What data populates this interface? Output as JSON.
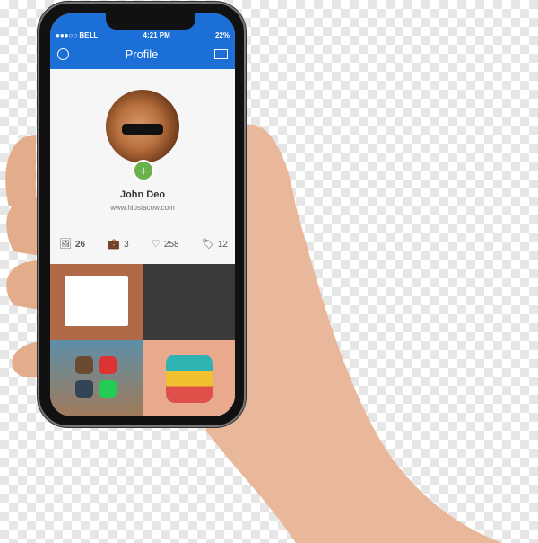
{
  "status_bar": {
    "carrier": "●●●○○ BELL",
    "time": "4:21 PM",
    "battery": "22%"
  },
  "header": {
    "title": "Profile",
    "menu_icon": "menu-icon",
    "mail_icon": "mail-icon",
    "color": "#1b6fd6"
  },
  "profile": {
    "name": "John Deo",
    "website": "www.hipstacow.com"
  },
  "stats": [
    {
      "icon": "image-icon",
      "glyph": "🖼",
      "value": "26"
    },
    {
      "icon": "briefcase-icon",
      "glyph": "💼",
      "value": "3"
    },
    {
      "icon": "heart-icon",
      "glyph": "♡",
      "value": "258"
    },
    {
      "icon": "tag-icon",
      "glyph": "🏷",
      "value": "12"
    }
  ]
}
